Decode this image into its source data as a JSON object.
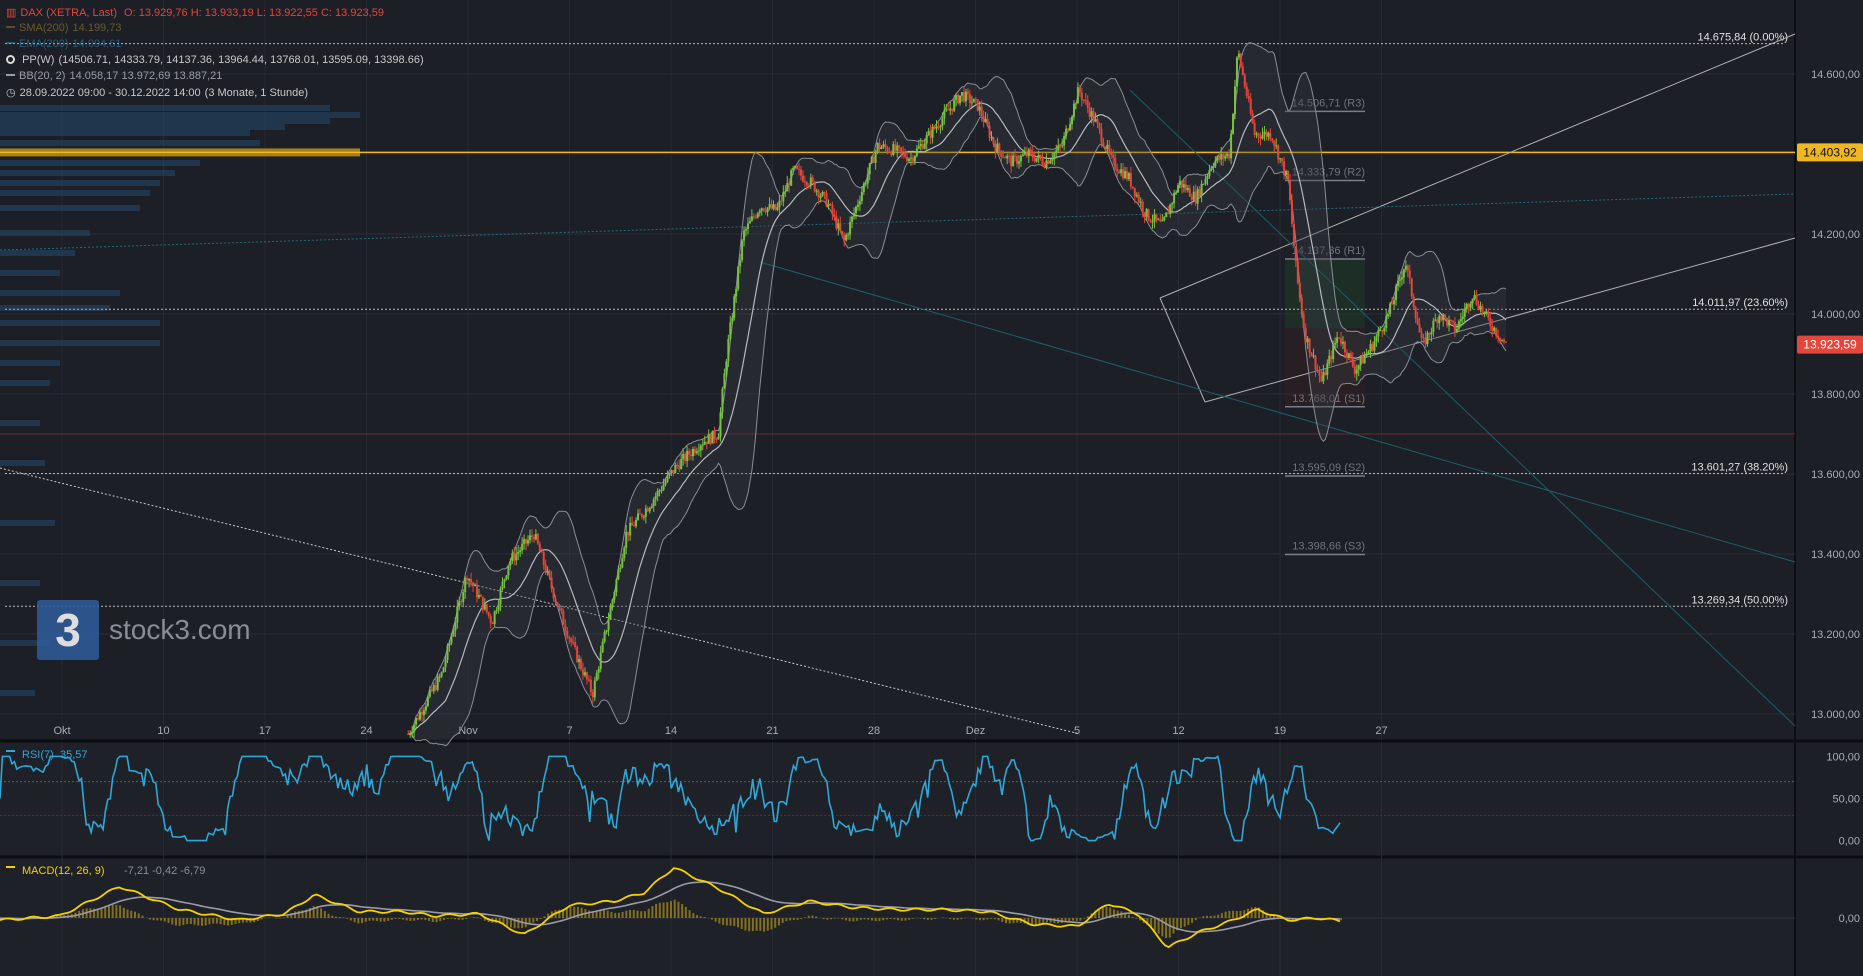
{
  "legend": {
    "instrument": "DAX (XETRA, Last)",
    "ohlc": "O: 13.929,76  H: 13.933,19  L: 13.922,55  C: 13.923,59",
    "sma_label": "SMA(200)",
    "sma_value": "14.199,73",
    "ema_label": "EMA(200)",
    "ema_value": "14.094,61",
    "pp_label": "PP(W)",
    "pp_values": "(14506.71, 14333.79, 14137.36, 13964.44, 13768.01, 13595.09, 13398.66)",
    "bb_label": "BB(20, 2)",
    "bb_values": "14.058,17  13.972,69  13.887,21",
    "period": "28.09.2022 09:00 - 30.12.2022 14:00",
    "period_note": "(3 Monate, 1 Stunde)"
  },
  "logo": {
    "mark": "3",
    "text": "stock3.com"
  },
  "colors": {
    "up": "#79c142",
    "down": "#e5453a",
    "rsi": "#2fa7d9",
    "macd": "#f5d200",
    "signal": "#9a9aa8",
    "hist": "#a68a18",
    "price_badge": "#e5453a",
    "level_badge": "#f0b81e"
  },
  "chart_data": [
    {
      "type": "candlestick",
      "title": "DAX (XETRA, Last)",
      "ylim": [
        12950,
        14700
      ],
      "x_ticks": [
        "Okt",
        "10",
        "17",
        "24",
        "Nov",
        "7",
        "14",
        "21",
        "28",
        "Dez",
        "5",
        "12",
        "19",
        "27"
      ],
      "y_ticks": [
        "14.600,00",
        "14.400,00",
        "14.200,00",
        "14.000,00",
        "13.800,00",
        "13.600,00",
        "13.400,00",
        "13.200,00",
        "13.000,00"
      ],
      "last_price": "13.923,59",
      "key_level": "14.403,92",
      "path": [
        [
          24,
          12950
        ],
        [
          26,
          13100
        ],
        [
          27.5,
          13350
        ],
        [
          29,
          13230
        ],
        [
          30,
          13380
        ],
        [
          31.5,
          13450
        ],
        [
          33,
          13260
        ],
        [
          34,
          13150
        ],
        [
          35,
          13050
        ],
        [
          36,
          13250
        ],
        [
          37,
          13450
        ],
        [
          38.5,
          13530
        ],
        [
          40,
          13620
        ],
        [
          41.5,
          13680
        ],
        [
          42.5,
          13700
        ],
        [
          43,
          13900
        ],
        [
          44,
          14200
        ],
        [
          45,
          14270
        ],
        [
          46,
          14260
        ],
        [
          47,
          14360
        ],
        [
          48,
          14330
        ],
        [
          49,
          14280
        ],
        [
          50,
          14180
        ],
        [
          51,
          14300
        ],
        [
          52,
          14420
        ],
        [
          53,
          14410
        ],
        [
          54,
          14390
        ],
        [
          55.5,
          14470
        ],
        [
          57,
          14550
        ],
        [
          58,
          14520
        ],
        [
          59,
          14420
        ],
        [
          60,
          14380
        ],
        [
          61,
          14400
        ],
        [
          62,
          14380
        ],
        [
          63,
          14420
        ],
        [
          64,
          14560
        ],
        [
          65,
          14480
        ],
        [
          66,
          14380
        ],
        [
          67,
          14340
        ],
        [
          68,
          14250
        ],
        [
          69,
          14220
        ],
        [
          70,
          14330
        ],
        [
          71,
          14290
        ],
        [
          72,
          14380
        ],
        [
          73,
          14400
        ],
        [
          73.5,
          14660
        ],
        [
          74.5,
          14450
        ],
        [
          75.5,
          14450
        ],
        [
          76.5,
          14330
        ],
        [
          77,
          14100
        ],
        [
          77.5,
          13950
        ],
        [
          78.5,
          13830
        ],
        [
          79.5,
          13950
        ],
        [
          80.5,
          13860
        ],
        [
          81.5,
          13920
        ],
        [
          82.5,
          14000
        ],
        [
          83.5,
          14130
        ],
        [
          84.5,
          13920
        ],
        [
          85.5,
          14000
        ],
        [
          86.5,
          13960
        ],
        [
          87.5,
          14050
        ],
        [
          88.5,
          13980
        ],
        [
          89.5,
          13924
        ]
      ],
      "pivot_levels": [
        {
          "label": "14.506,71 (R3)",
          "value": 14506.71
        },
        {
          "label": "14.333,79 (R2)",
          "value": 14333.79
        },
        {
          "label": "14.137,36 (R1)",
          "value": 14137.36
        },
        {
          "label": "13.768,01 (S1)",
          "value": 13768.01
        },
        {
          "label": "13.595,09 (S2)",
          "value": 13595.09
        },
        {
          "label": "13.398,66 (S3)",
          "value": 13398.66
        }
      ],
      "fib_levels": [
        {
          "label": "14.675,84 (0.00%)",
          "value": 14675.84
        },
        {
          "label": "14.011,97 (23.60%)",
          "value": 14011.97
        },
        {
          "label": "13.601,27 (38.20%)",
          "value": 13601.27
        },
        {
          "label": "13.269,34 (50.00%)",
          "value": 13269.34
        }
      ]
    },
    {
      "type": "line",
      "title": "RSI(7)",
      "value_label": "35,57",
      "ylim": [
        -10,
        110
      ],
      "y_ticks": [
        "100,00",
        "50,00",
        "0,00"
      ],
      "bands": [
        70,
        30
      ]
    },
    {
      "type": "line",
      "title": "MACD(12, 26, 9)",
      "values_label": "-7,21  -0,42  -6,79",
      "y_ticks": [
        "0,00"
      ],
      "path": [
        [
          0,
          -5
        ],
        [
          4,
          5
        ],
        [
          8,
          75
        ],
        [
          12,
          20
        ],
        [
          16,
          -5
        ],
        [
          19,
          10
        ],
        [
          21,
          55
        ],
        [
          24,
          15
        ],
        [
          27,
          15
        ],
        [
          29,
          5
        ],
        [
          32,
          10
        ],
        [
          35,
          -40
        ],
        [
          38,
          30
        ],
        [
          41,
          40
        ],
        [
          43,
          60
        ],
        [
          45,
          120
        ],
        [
          48,
          70
        ],
        [
          51,
          10
        ],
        [
          54,
          40
        ],
        [
          57,
          25
        ],
        [
          60,
          20
        ],
        [
          63,
          20
        ],
        [
          66,
          15
        ],
        [
          69,
          -15
        ],
        [
          72,
          -20
        ],
        [
          74,
          35
        ],
        [
          76,
          10
        ],
        [
          78,
          -70
        ],
        [
          80,
          -35
        ],
        [
          82,
          -10
        ],
        [
          84,
          20
        ],
        [
          86,
          -5
        ],
        [
          88,
          0
        ],
        [
          89.5,
          -7
        ]
      ]
    }
  ]
}
